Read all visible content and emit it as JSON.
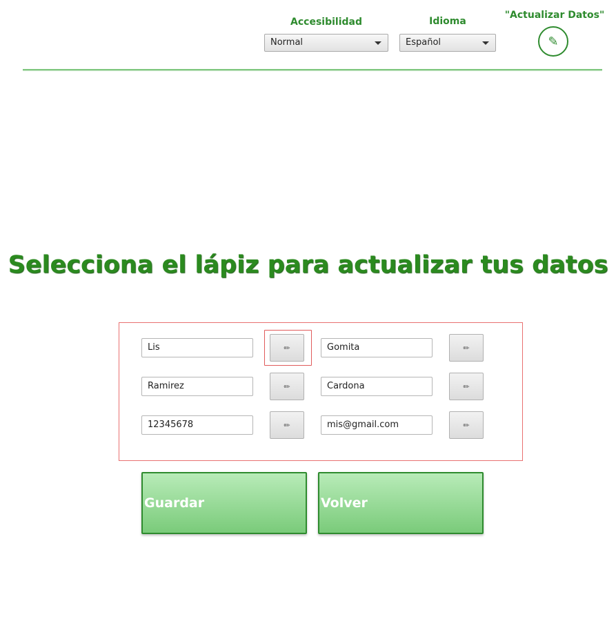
{
  "header": {
    "accessibility_label": "Accesibilidad",
    "accessibility_value": "Normal",
    "language_label": "Idioma",
    "language_value": "Español",
    "update_label": "\"Actualizar Datos\"",
    "update_icon": "pencil-icon"
  },
  "main": {
    "title": "Selecciona el lápiz para actualizar tus datos"
  },
  "form": {
    "edit_icon": "✏",
    "fields": [
      "Lis",
      "Gomita",
      "Ramirez",
      "Cardona",
      "12345678",
      "mis@gmail.com"
    ]
  },
  "actions": {
    "save_label": "Guardar",
    "back_label": "Volver"
  },
  "colors": {
    "accent": "#2e8b2e",
    "title": "#2b8a1f",
    "focus": "#e05a5a"
  }
}
